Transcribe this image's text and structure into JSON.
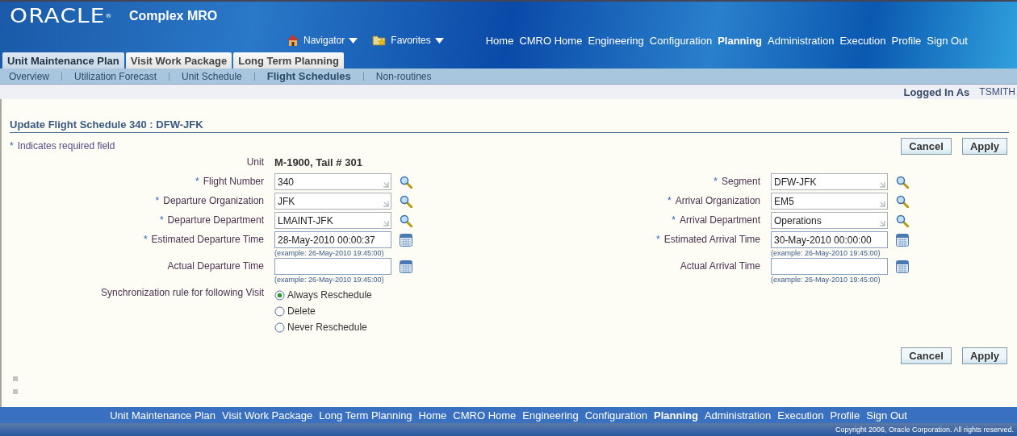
{
  "header": {
    "logo": "ORACLE",
    "logo_mark": "®",
    "app_title": "Complex MRO",
    "menus": [
      {
        "label": "Navigator",
        "kind": "home"
      },
      {
        "label": "Favorites",
        "kind": "folder"
      }
    ],
    "global_links": [
      {
        "label": "Home",
        "selected": false
      },
      {
        "label": "CMRO Home",
        "selected": false
      },
      {
        "label": "Engineering",
        "selected": false
      },
      {
        "label": "Configuration",
        "selected": false
      },
      {
        "label": "Planning",
        "selected": true
      },
      {
        "label": "Administration",
        "selected": false
      },
      {
        "label": "Execution",
        "selected": false
      },
      {
        "label": "Profile",
        "selected": false
      },
      {
        "label": "Sign Out",
        "selected": false
      }
    ]
  },
  "tabs": [
    {
      "label": "Unit Maintenance Plan",
      "selected": true
    },
    {
      "label": "Visit Work Package",
      "selected": false
    },
    {
      "label": "Long Term Planning",
      "selected": false
    }
  ],
  "subtabs": [
    {
      "label": "Overview",
      "selected": false
    },
    {
      "label": "Utilization Forecast",
      "selected": false
    },
    {
      "label": "Unit Schedule",
      "selected": false
    },
    {
      "label": "Flight Schedules",
      "selected": true
    },
    {
      "label": "Non-routines",
      "selected": false
    }
  ],
  "user": {
    "label": "Logged In As",
    "name": "TSMITH"
  },
  "page": {
    "title": "Update Flight Schedule 340 : DFW-JFK",
    "required_note": {
      "mark": "*",
      "text": "Indicates required field"
    },
    "buttons": [
      "Cancel",
      "Apply"
    ],
    "unit": {
      "label": "Unit",
      "value": "M-1900, Tail # 301"
    },
    "left_fields": [
      {
        "kind": "lov",
        "mark": "*",
        "label": "Flight Number",
        "value": "340"
      },
      {
        "kind": "lov",
        "mark": "*",
        "label": "Departure Organization",
        "value": "JFK"
      },
      {
        "kind": "lov",
        "mark": "*",
        "label": "Departure Department",
        "value": "LMAINT-JFK"
      },
      {
        "kind": "date",
        "mark": "*",
        "label": "Estimated Departure Time",
        "value": "28-May-2010 00:00:37",
        "hint": "(example: 26-May-2010 19:45:00)"
      },
      {
        "kind": "date",
        "label": "Actual Departure Time",
        "hint": "(example: 26-May-2010 19:45:00)"
      }
    ],
    "right_fields": [
      {
        "kind": "lov",
        "mark": "*",
        "label": "Segment",
        "value": "DFW-JFK"
      },
      {
        "kind": "lov",
        "mark": "*",
        "label": "Arrival Organization",
        "value": "EM5"
      },
      {
        "kind": "lov",
        "mark": "*",
        "label": "Arrival Department",
        "value": "Operations"
      },
      {
        "kind": "date",
        "mark": "*",
        "label": "Estimated Arrival Time",
        "value": "30-May-2010 00:00:00",
        "hint": "(example: 26-May-2010 19:45:00)"
      },
      {
        "kind": "date",
        "label": "Actual Arrival Time",
        "hint": "(example: 26-May-2010 19:45:00)"
      }
    ],
    "sync": {
      "label": "Synchronization rule for following Visit",
      "options": [
        {
          "label": "Always Reschedule",
          "selected": true
        },
        {
          "label": "Delete",
          "selected": false
        },
        {
          "label": "Never Reschedule",
          "selected": false
        }
      ]
    },
    "bottom_buttons": [
      "Cancel",
      "Apply"
    ]
  },
  "footer": {
    "links": [
      {
        "label": "Unit Maintenance Plan",
        "selected": false
      },
      {
        "label": "Visit Work Package",
        "selected": false
      },
      {
        "label": "Long Term Planning",
        "selected": false
      },
      {
        "label": "Home",
        "selected": false
      },
      {
        "label": "CMRO Home",
        "selected": false
      },
      {
        "label": "Engineering",
        "selected": false
      },
      {
        "label": "Configuration",
        "selected": false
      },
      {
        "label": "Planning",
        "selected": true
      },
      {
        "label": "Administration",
        "selected": false
      },
      {
        "label": "Execution",
        "selected": false
      },
      {
        "label": "Profile",
        "selected": false
      },
      {
        "label": "Sign Out",
        "selected": false
      }
    ],
    "copyright": "Copyright 2006, Oracle Corporation. All rights reserved."
  }
}
